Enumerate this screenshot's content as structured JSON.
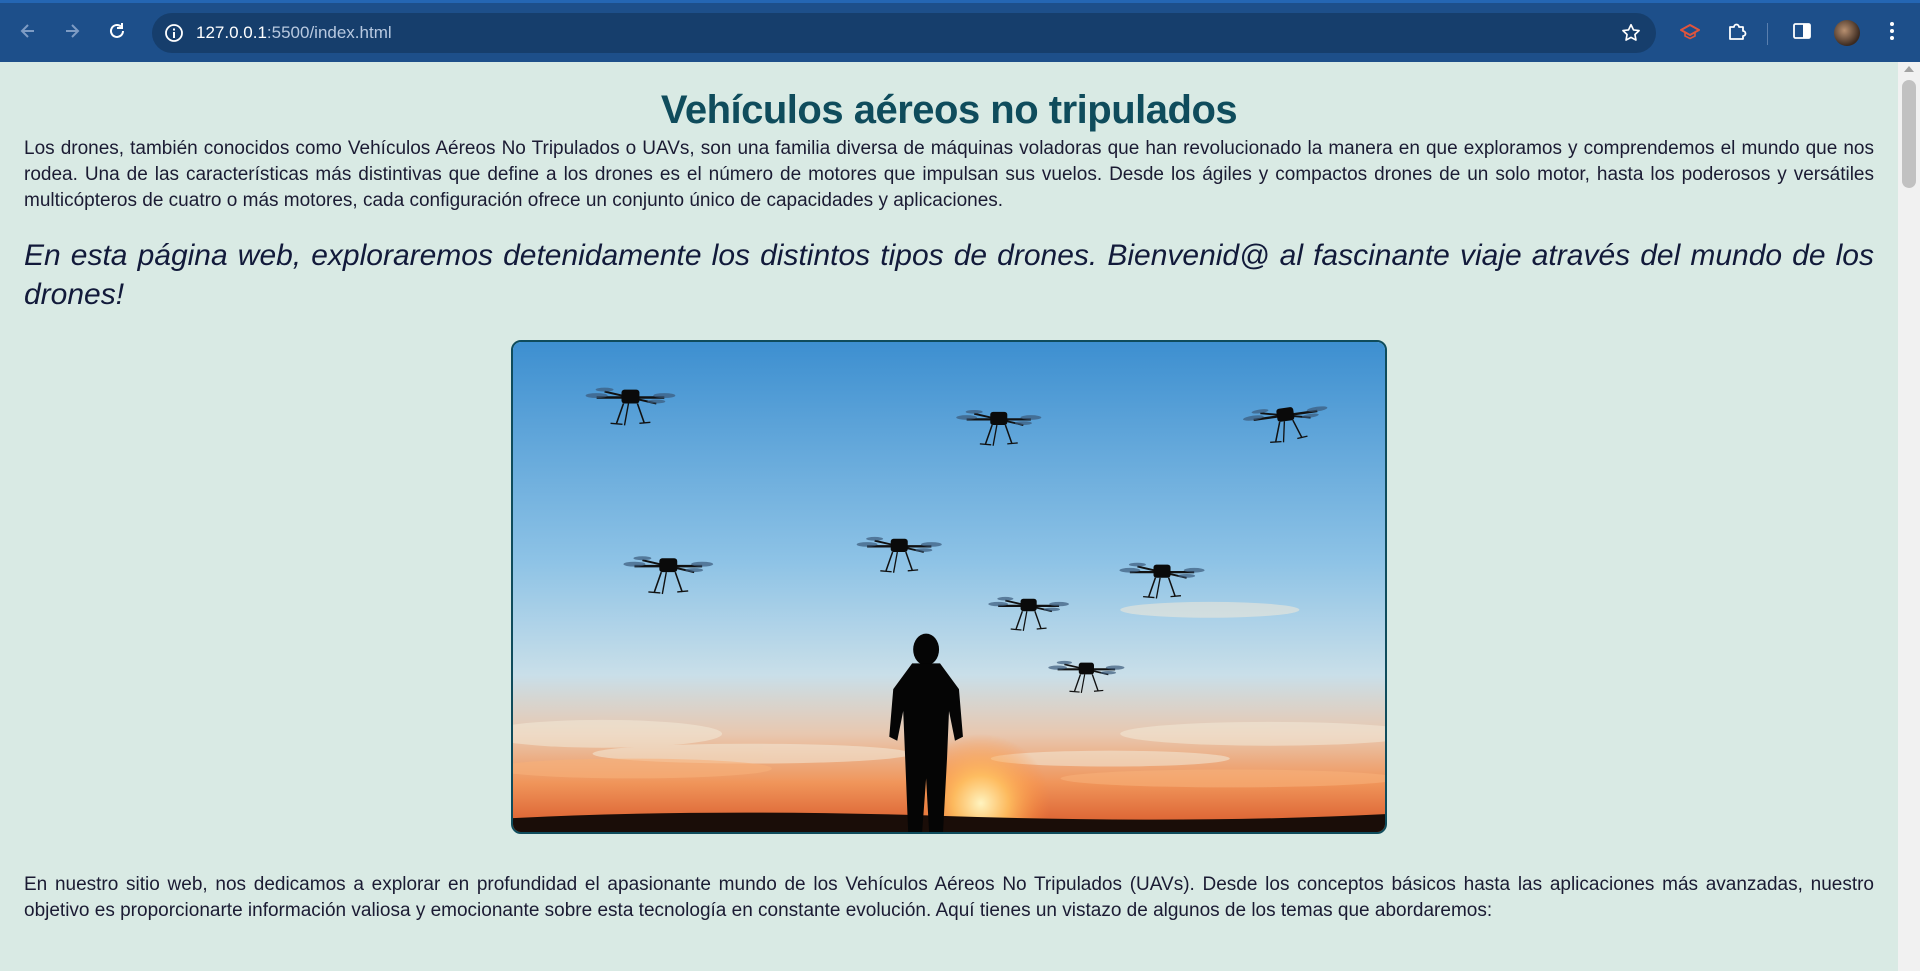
{
  "browser": {
    "url_host": "127.0.0.1",
    "url_path": ":5500/index.html"
  },
  "page": {
    "title": "Vehículos aéreos no tripulados",
    "intro": "Los drones, también conocidos como Vehículos Aéreos No Tripulados o UAVs, son una familia diversa de máquinas voladoras que han revolucionado la manera en que exploramos y comprendemos el mundo que nos rodea. Una de las características más distintivas que define a los drones es el número de motores que impulsan sus vuelos. Desde los ágiles y compactos drones de un solo motor, hasta los poderosos y versátiles multicópteros de cuatro o más motores, cada configuración ofrece un conjunto único de capacidades y aplicaciones.",
    "welcome": "En esta página web, exploraremos detenidamente los distintos tipos de drones. Bienvenid@ al fascinante viaje através del mundo de los drones!",
    "body2": "En nuestro sitio web, nos dedicamos a explorar en profundidad el apasionante mundo de los Vehículos Aéreos No Tripulados (UAVs). Desde los conceptos básicos hasta las aplicaciones más avanzadas, nuestro objetivo es proporcionarte información valiosa y emocionante sobre esta tecnología en constante evolución. Aquí tienes un vistazo de algunos de los temas que abordaremos:"
  },
  "icons": {
    "back": "arrow-left-icon",
    "forward": "arrow-right-icon",
    "reload": "reload-icon",
    "info": "info-icon",
    "bookmark": "star-icon",
    "extension_1": "graduation-cap-icon",
    "extensions": "puzzle-icon",
    "side_panel": "side-panel-icon",
    "menu": "kebab-menu-icon"
  },
  "colors": {
    "browser_bar": "#1d4f8a",
    "page_bg": "#d9eae4",
    "title": "#0f4c5c"
  }
}
